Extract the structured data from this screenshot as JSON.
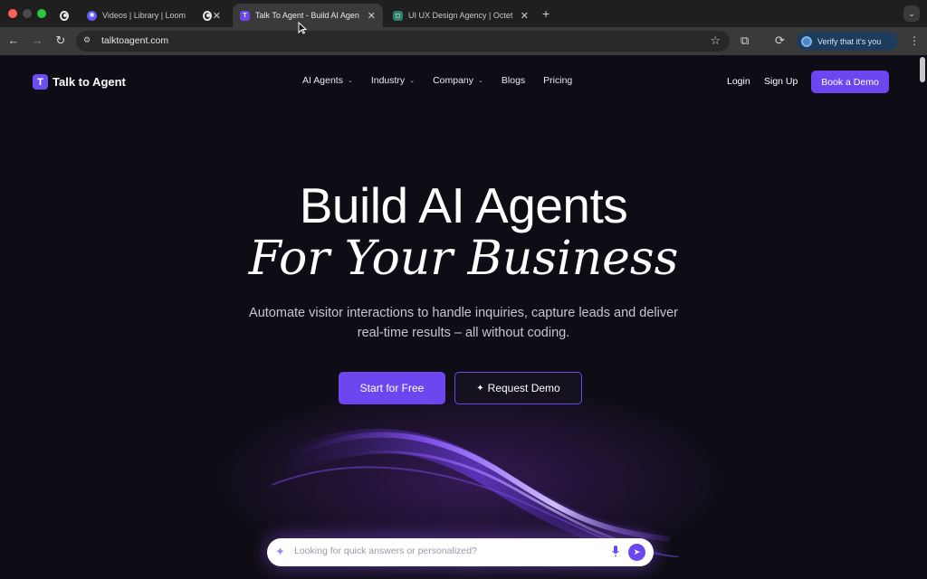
{
  "browser": {
    "tabs": [
      {
        "title": "",
        "active": false
      },
      {
        "title": "Videos | Library | Loom",
        "active": false
      },
      {
        "title": "",
        "active": false
      },
      {
        "title": "Talk To Agent - Build AI Agen",
        "active": true
      },
      {
        "title": "UI UX Design Agency | Octet",
        "active": false
      }
    ],
    "url": "talktoagent.com",
    "verify_label": "Verify that it's you",
    "new_tab_symbol": "+"
  },
  "site": {
    "logo_text": "Talk to Agent",
    "logo_letter": "T",
    "nav": [
      "AI Agents",
      "Industry",
      "Company",
      "Blogs",
      "Pricing"
    ],
    "login": "Login",
    "signup": "Sign Up",
    "book_demo": "Book a Demo"
  },
  "hero": {
    "title": "Build AI Agents",
    "title_italic": "For Your Business",
    "subtitle": "Automate visitor interactions to handle inquiries, capture leads and deliver real-time results – all without coding.",
    "primary_cta": "Start for Free",
    "secondary_cta": "Request Demo"
  },
  "ask": {
    "placeholder": "Looking for quick answers or personalized?"
  },
  "colors": {
    "accent": "#6c47f0",
    "background": "#0e0c14"
  }
}
